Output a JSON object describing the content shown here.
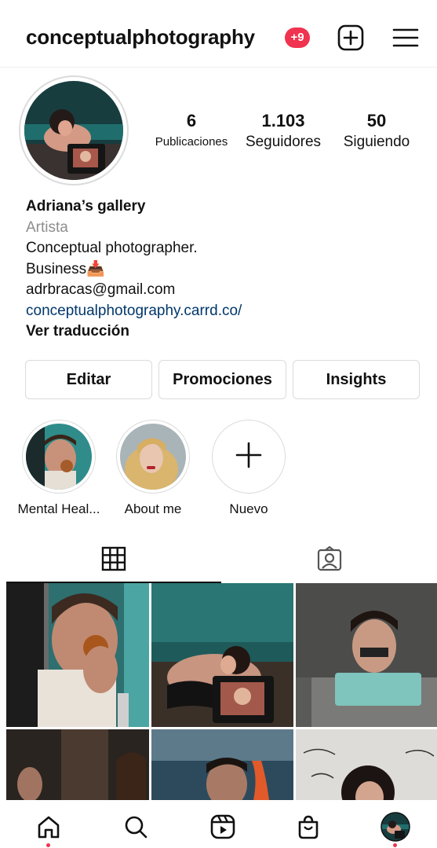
{
  "header": {
    "username": "conceptualphotography",
    "notification_badge": "+9",
    "new_post_icon": "plus-square-icon",
    "menu_icon": "hamburger-menu-icon"
  },
  "profile": {
    "stats": [
      {
        "value": "6",
        "label": "Publicaciones"
      },
      {
        "value": "1.103",
        "label": "Seguidores"
      },
      {
        "value": "50",
        "label": "Siguiendo"
      }
    ],
    "bio": {
      "name": "Adriana’s gallery",
      "category": "Artista",
      "line1": "Conceptual photographer.",
      "line2": "Business📥",
      "email": "adrbracas@gmail.com",
      "link": "conceptualphotography.carrd.co/",
      "translate": "Ver traducción"
    }
  },
  "actions": {
    "edit": "Editar",
    "promotions": "Promociones",
    "insights": "Insights"
  },
  "highlights": [
    {
      "label": "Mental Heal..."
    },
    {
      "label": "About me"
    },
    {
      "label": "Nuevo"
    }
  ],
  "tabs": {
    "grid_icon": "grid-icon",
    "tagged_icon": "tagged-person-icon"
  },
  "bottom_nav": [
    "home-icon",
    "search-icon",
    "reels-icon",
    "shop-icon",
    "profile-avatar"
  ],
  "colors": {
    "badge": "#f0334f",
    "link": "#00376b",
    "muted": "#8e8e8e",
    "border": "#dbdbdb"
  }
}
